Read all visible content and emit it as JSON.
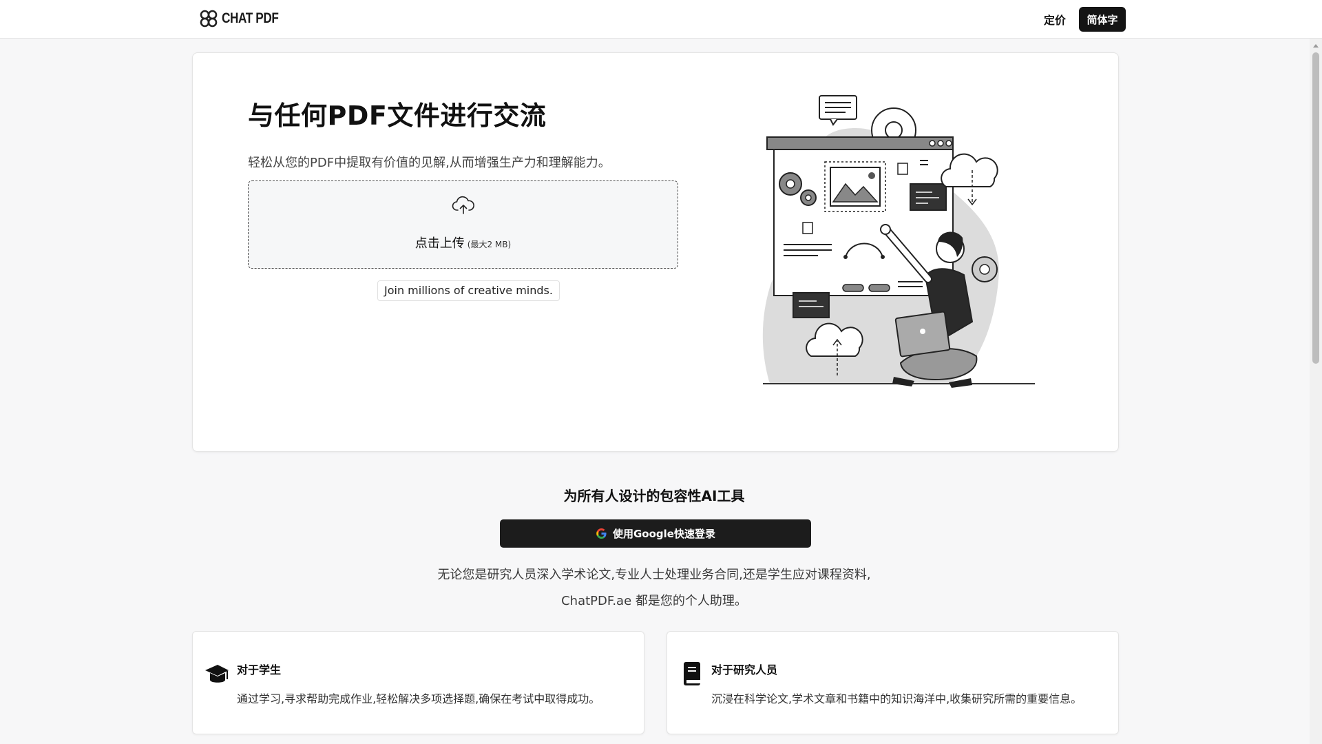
{
  "header": {
    "logo_text": "CHAT PDF",
    "nav_pricing": "定价",
    "lang_button": "简体字"
  },
  "hero": {
    "title": "与任何PDF文件进行交流",
    "subtitle": "轻松从您的PDF中提取有价值的见解,从而增强生产力和理解能力。",
    "upload_label": "点击上传",
    "upload_limit": "(最大2 MB)",
    "join_text": "Join millions of creative minds."
  },
  "section": {
    "title": "为所有人设计的包容性AI工具",
    "google_button": "使用Google快速登录",
    "description_line1": "无论您是研究人员深入学术论文,专业人士处理业务合同,还是学生应对课程资料,",
    "description_line2": "ChatPDF.ae 都是您的个人助理。"
  },
  "cards": [
    {
      "icon": "graduation-cap-icon",
      "title": "对于学生",
      "text": "通过学习,寻求帮助完成作业,轻松解决多项选择题,确保在考试中取得成功。"
    },
    {
      "icon": "book-icon",
      "title": "对于研究人员",
      "text": "沉浸在科学论文,学术文章和书籍中的知识海洋中,收集研究所需的重要信息。"
    }
  ],
  "colors": {
    "background": "#f7f7f8",
    "dark_button": "#1c1c1c",
    "text": "#111111"
  }
}
